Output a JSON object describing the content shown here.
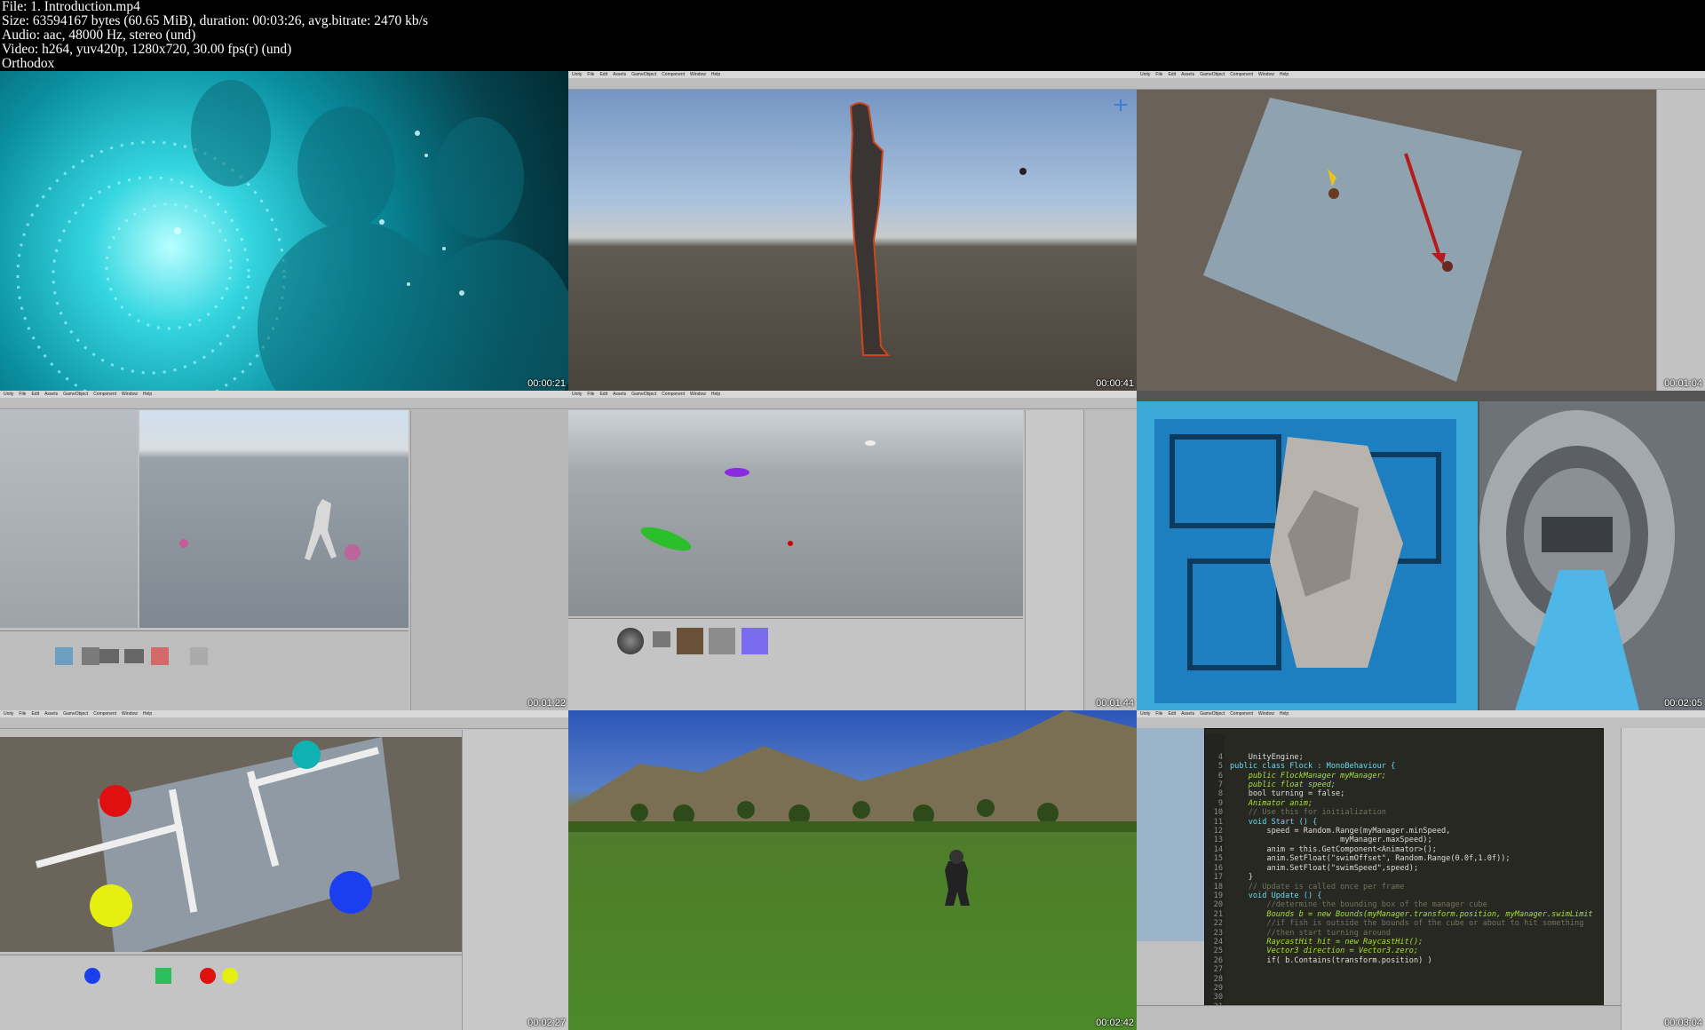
{
  "header": {
    "file": "File: 1. Introduction.mp4",
    "size": "Size: 63594167 bytes (60.65 MiB), duration: 00:03:26, avg.bitrate: 2470 kb/s",
    "audio": "Audio: aac, 48000 Hz, stereo (und)",
    "video": "Video: h264, yuv420p, 1280x720, 30.00 fps(r) (und)",
    "author": "Orthodox"
  },
  "thumbnails": [
    {
      "timestamp": "00:00:21"
    },
    {
      "timestamp": "00:00:41"
    },
    {
      "timestamp": "00:01:04"
    },
    {
      "timestamp": "00:01:22"
    },
    {
      "timestamp": "00:01:44"
    },
    {
      "timestamp": "00:02:05"
    },
    {
      "timestamp": "00:02:27"
    },
    {
      "timestamp": "00:02:42"
    },
    {
      "timestamp": "00:03:04"
    }
  ],
  "unity_menu": [
    "Unity",
    "File",
    "Edit",
    "Assets",
    "GameObject",
    "Component",
    "Window",
    "Help"
  ],
  "code_lines": [
    "    UnityEngine;",
    "public class Flock : MonoBehaviour {",
    "",
    "    public FlockManager myManager;",
    "    public float speed;",
    "    bool turning = false;",
    "    Animator anim;",
    "",
    "    // Use this for initialization",
    "    void Start () {",
    "        speed = Random.Range(myManager.minSpeed,",
    "                        myManager.maxSpeed);",
    "        anim = this.GetComponent<Animator>();",
    "        anim.SetFloat(\"swimOffset\", Random.Range(0.0f,1.0f));",
    "        anim.SetFloat(\"swimSpeed\",speed);",
    "    }",
    "",
    "    // Update is called once per frame",
    "    void Update () {",
    "",
    "        //determine the bounding box of the manager cube",
    "        Bounds b = new Bounds(myManager.transform.position, myManager.swimLimit",
    "",
    "        //if fish is outside the bounds of the cube or about to hit something",
    "        //then start turning around",
    "        RaycastHit hit = new RaycastHit();",
    "        Vector3 direction = Vector3.zero;",
    "",
    "        if( b.Contains(transform.position) )"
  ],
  "line_numbers": [
    "4",
    "5",
    "6",
    "7",
    "8",
    "9",
    "10",
    "11",
    "12",
    "13",
    "14",
    "15",
    "16",
    "17",
    "18",
    "19",
    "20",
    "21",
    "22",
    "23",
    "24",
    "25",
    "26",
    "27",
    "28",
    "29",
    "30",
    "31",
    "32"
  ]
}
